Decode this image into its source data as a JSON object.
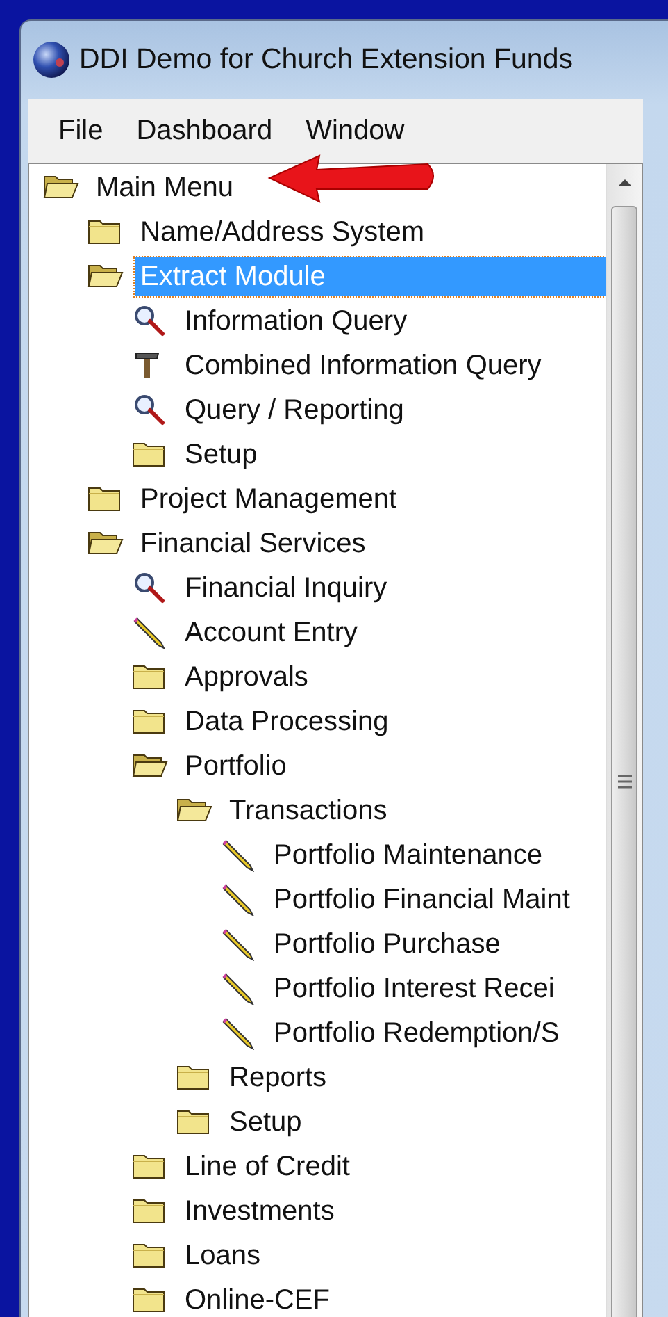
{
  "window": {
    "title": "DDI Demo for Church Extension Funds"
  },
  "menu": [
    "File",
    "Dashboard",
    "Window"
  ],
  "tree": [
    {
      "label": "Main Menu",
      "kind": "folder",
      "expanded": true,
      "selected": false,
      "children": [
        {
          "label": "Name/Address System",
          "kind": "folder",
          "expanded": false,
          "selected": false
        },
        {
          "label": "Extract Module",
          "kind": "folder",
          "expanded": true,
          "selected": true,
          "children": [
            {
              "label": "Information Query",
              "kind": "search",
              "selected": false
            },
            {
              "label": "Combined Information Query",
              "kind": "hammer",
              "selected": false
            },
            {
              "label": "Query / Reporting",
              "kind": "search",
              "selected": false
            },
            {
              "label": "Setup",
              "kind": "folder",
              "expanded": false,
              "selected": false
            }
          ]
        },
        {
          "label": "Project Management",
          "kind": "folder",
          "expanded": false,
          "selected": false
        },
        {
          "label": "Financial Services",
          "kind": "folder",
          "expanded": true,
          "selected": false,
          "children": [
            {
              "label": "Financial Inquiry",
              "kind": "search",
              "selected": false
            },
            {
              "label": "Account Entry",
              "kind": "pencil",
              "selected": false
            },
            {
              "label": "Approvals",
              "kind": "folder",
              "expanded": false,
              "selected": false
            },
            {
              "label": "Data Processing",
              "kind": "folder",
              "expanded": false,
              "selected": false
            },
            {
              "label": "Portfolio",
              "kind": "folder",
              "expanded": true,
              "selected": false,
              "children": [
                {
                  "label": "Transactions",
                  "kind": "folder",
                  "expanded": true,
                  "selected": false,
                  "children": [
                    {
                      "label": "Portfolio Maintenance",
                      "kind": "pencil",
                      "selected": false
                    },
                    {
                      "label": "Portfolio Financial Maint",
                      "kind": "pencil",
                      "selected": false
                    },
                    {
                      "label": "Portfolio Purchase",
                      "kind": "pencil",
                      "selected": false
                    },
                    {
                      "label": "Portfolio Interest Recei",
                      "kind": "pencil",
                      "selected": false
                    },
                    {
                      "label": "Portfolio Redemption/S",
                      "kind": "pencil",
                      "selected": false
                    }
                  ]
                },
                {
                  "label": "Reports",
                  "kind": "folder",
                  "expanded": false,
                  "selected": false
                },
                {
                  "label": "Setup",
                  "kind": "folder",
                  "expanded": false,
                  "selected": false
                }
              ]
            },
            {
              "label": "Line of Credit",
              "kind": "folder",
              "expanded": false,
              "selected": false
            },
            {
              "label": "Investments",
              "kind": "folder",
              "expanded": false,
              "selected": false
            },
            {
              "label": "Loans",
              "kind": "folder",
              "expanded": false,
              "selected": false
            },
            {
              "label": "Online-CEF",
              "kind": "folder",
              "expanded": false,
              "selected": false
            }
          ]
        }
      ]
    }
  ]
}
